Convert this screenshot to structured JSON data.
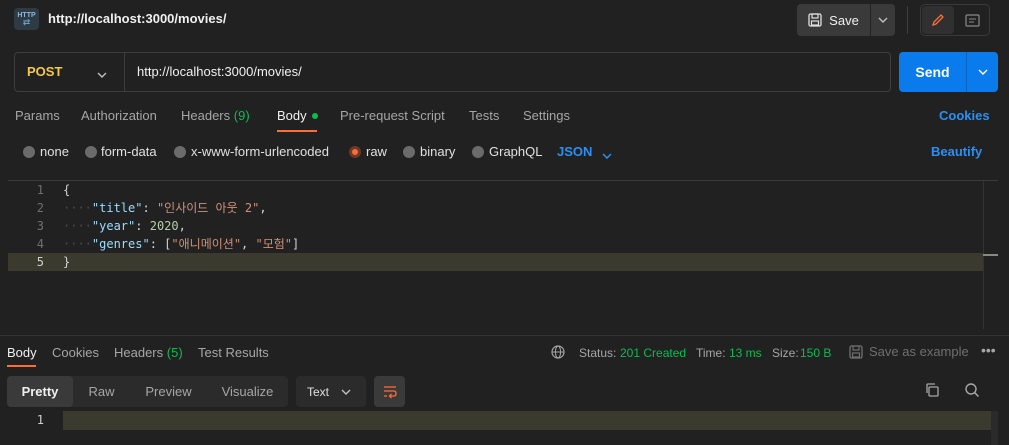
{
  "header": {
    "badge": "HTTP",
    "title": "http://localhost:3000/movies/",
    "save_label": "Save"
  },
  "request": {
    "method": "POST",
    "url": "http://localhost:3000/movies/",
    "send_label": "Send"
  },
  "request_tabs": {
    "params": "Params",
    "authorization": "Authorization",
    "headers": "Headers",
    "headers_count": "(9)",
    "body": "Body",
    "pre_request": "Pre-request Script",
    "tests": "Tests",
    "settings": "Settings",
    "cookies": "Cookies"
  },
  "body_types": {
    "none": "none",
    "form_data": "form-data",
    "urlencoded": "x-www-form-urlencoded",
    "raw": "raw",
    "binary": "binary",
    "graphql": "GraphQL",
    "format": "JSON",
    "beautify": "Beautify",
    "selected": "raw"
  },
  "editor": {
    "line_numbers": [
      "1",
      "2",
      "3",
      "4",
      "5"
    ],
    "open_brace": "{",
    "close_brace": "}",
    "title_key": "\"title\"",
    "title_value": "\"인사이드 아웃 2\"",
    "year_key": "\"year\"",
    "year_value": "2020",
    "genres_key": "\"genres\"",
    "genres_value_1": "\"애니메이션\"",
    "genres_value_2": "\"모험\""
  },
  "response": {
    "tabs": {
      "body": "Body",
      "cookies": "Cookies",
      "headers": "Headers",
      "headers_count": "(5)",
      "test_results": "Test Results"
    },
    "status_label": "Status:",
    "status_value": "201 Created",
    "time_label": "Time:",
    "time_value": "13 ms",
    "size_label": "Size:",
    "size_value": "150 B",
    "save_example": "Save as example",
    "more": "•••",
    "views": {
      "pretty": "Pretty",
      "raw": "Raw",
      "preview": "Preview",
      "visualize": "Visualize"
    },
    "format": "Text",
    "line_number": "1"
  },
  "colors": {
    "accent": "#ff6c37",
    "send": "#097bed",
    "link": "#2d8ff0",
    "success": "#0cbb52",
    "method": "#f5c84c"
  }
}
